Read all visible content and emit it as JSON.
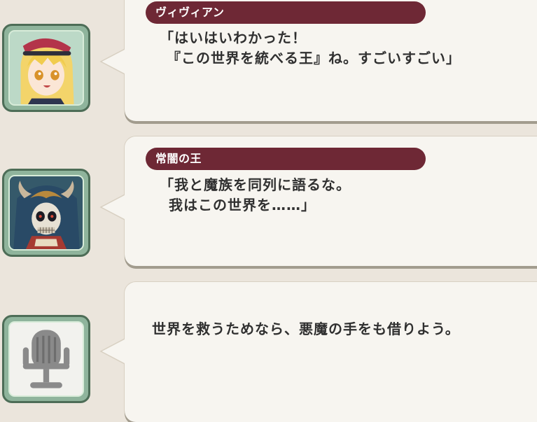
{
  "dialogue": [
    {
      "speaker": "ヴィヴィアン",
      "line1": "「はいはいわかった！",
      "line2": "『この世界を統べる王』ね。すごいすごい」",
      "avatar_icon": "blonde-girl-portrait"
    },
    {
      "speaker": "常闇の王",
      "line1": "「我と魔族を同列に語るな。",
      "line2": "我はこの世界を……」",
      "avatar_icon": "skull-king-portrait"
    },
    {
      "speaker": "",
      "line1": "世界を救うためなら、悪魔の手をも借りよう。",
      "avatar_icon": "microphone-icon"
    }
  ],
  "colors": {
    "nametag": "#6e2835",
    "avatar_frame": "#8fb49c",
    "bubble": "#f7f5f0",
    "background": "#ebe5dc"
  }
}
